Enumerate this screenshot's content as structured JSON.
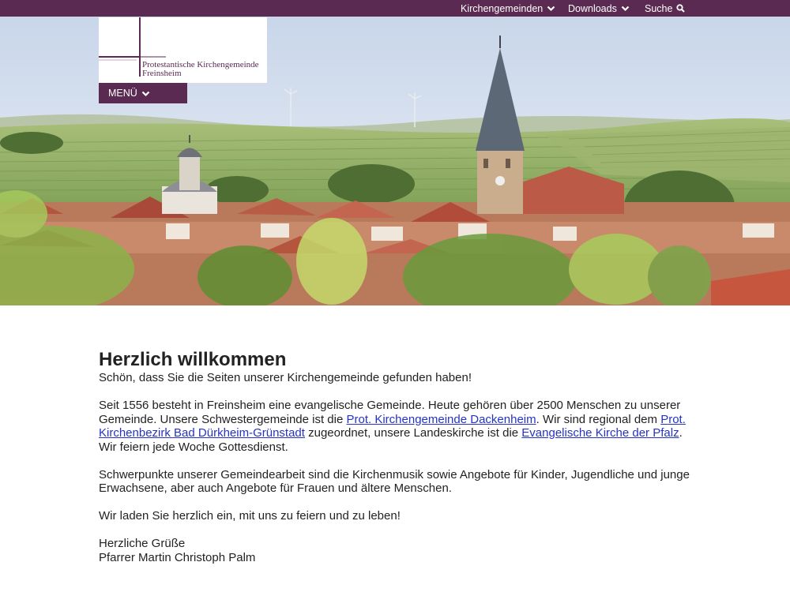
{
  "topnav": {
    "item1": "Kirchengemeinden",
    "item2": "Downloads",
    "item3": "Suche"
  },
  "logo": {
    "line1": "Protestantische Kirchengemeinde",
    "line2": "Freinsheim"
  },
  "menu": {
    "label": "MENÜ"
  },
  "content": {
    "title": "Herzlich willkommen",
    "intro": "Schön, dass Sie die Seiten unserer Kirchengemeinde gefunden haben!",
    "p1_a": "Seit 1556 besteht in Freinsheim eine evangelische Gemeinde. Heute gehören über 2500 Menschen zu unserer Gemeinde. Unsere Schwestergemeinde ist die ",
    "p1_link1": "Prot. Kirchengemeinde Dackenheim",
    "p1_b": ". Wir sind regional dem ",
    "p1_link2": "Prot. Kirchenbezirk Bad Dürkheim-Grünstadt",
    "p1_c": " zugeordnet, unsere Landeskirche ist die ",
    "p1_link3": "Evangelische Kirche der Pfalz",
    "p1_d": ". Wir feiern jede Woche Gottesdienst.",
    "p2": "Schwerpunkte unserer Gemeindearbeit sind die Kirchenmusik sowie Angebote für Kinder, Jugendliche und junge Erwachsene, aber auch Angebote für Frauen und ältere Menschen.",
    "p3": "Wir laden Sie herzlich ein, mit uns zu feiern und zu leben!",
    "closing": "Herzliche Grüße",
    "signature": "Pfarrer Martin Christoph Palm"
  },
  "colors": {
    "brand": "#5a2a52",
    "link": "#2533c7"
  }
}
